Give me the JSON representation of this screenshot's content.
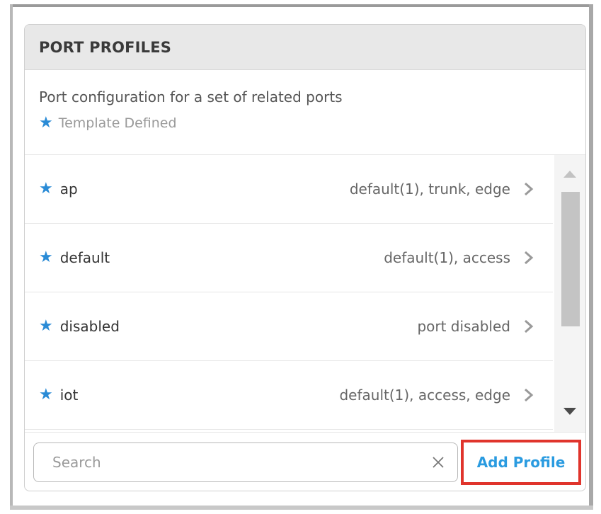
{
  "panel": {
    "title": "PORT PROFILES",
    "description": "Port configuration for a set of related ports",
    "legend_symbol": "★",
    "legend_label": "Template Defined",
    "accent_color": "#2a8bd6"
  },
  "profiles": [
    {
      "name": "ap",
      "detail": "default(1), trunk, edge",
      "template_defined": true
    },
    {
      "name": "default",
      "detail": "default(1), access",
      "template_defined": true
    },
    {
      "name": "disabled",
      "detail": "port disabled",
      "template_defined": true
    },
    {
      "name": "iot",
      "detail": "default(1), access, edge",
      "template_defined": true
    }
  ],
  "footer": {
    "search_placeholder": "Search",
    "search_value": "",
    "add_button_label": "Add Profile",
    "add_button_color": "#2a9be0",
    "highlight_color": "#e0342c"
  },
  "icons": {
    "star": "star-icon",
    "row_chevron": "chevron-right-icon",
    "clear": "close-icon",
    "scroll_up": "arrow-up-icon",
    "scroll_down": "arrow-down-icon"
  }
}
